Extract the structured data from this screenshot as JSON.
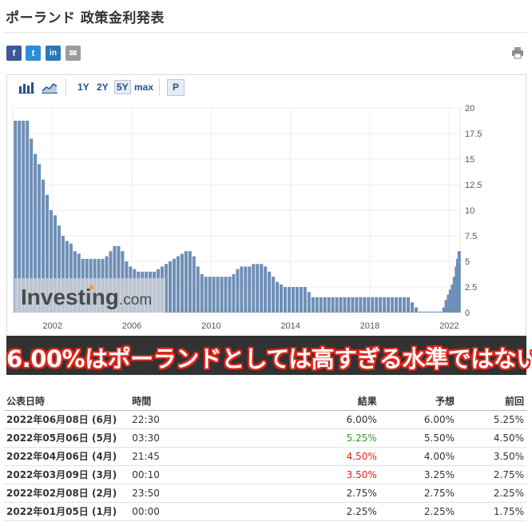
{
  "page": {
    "title": "ポーランド 政策金利発表"
  },
  "share": {
    "facebook": "f",
    "twitter": "t",
    "linkedin": "in",
    "email": "✉"
  },
  "toolbar": {
    "ranges": [
      "1Y",
      "2Y",
      "5Y",
      "max"
    ],
    "active_range": "5Y",
    "p_button": "P"
  },
  "watermark": {
    "brand": "Investing",
    "suffix": ".com"
  },
  "banner": {
    "text": "6.00%はポーランドとしては高すぎる水準ではない"
  },
  "chart_data": {
    "type": "bar",
    "title": "",
    "xlabel": "",
    "ylabel": "",
    "ylim": [
      0,
      20
    ],
    "y_ticks": [
      "0",
      "2.5",
      "5",
      "7.5",
      "10",
      "12.5",
      "15",
      "17.5",
      "20"
    ],
    "x_ticks": [
      "2002",
      "2006",
      "2010",
      "2014",
      "2018",
      "2022"
    ],
    "x_range": [
      2000.0,
      2022.55
    ],
    "grid": true,
    "legend": "none",
    "color": "#6e8fb6",
    "points": [
      [
        2000.15,
        18.75
      ],
      [
        2000.35,
        18.75
      ],
      [
        2000.55,
        18.75
      ],
      [
        2000.75,
        18.75
      ],
      [
        2000.95,
        17.0
      ],
      [
        2001.15,
        15.5
      ],
      [
        2001.35,
        14.5
      ],
      [
        2001.55,
        13.0
      ],
      [
        2001.75,
        11.5
      ],
      [
        2001.95,
        10.0
      ],
      [
        2002.15,
        9.5
      ],
      [
        2002.35,
        8.5
      ],
      [
        2002.55,
        7.5
      ],
      [
        2002.75,
        7.0
      ],
      [
        2002.95,
        6.75
      ],
      [
        2003.15,
        6.0
      ],
      [
        2003.35,
        5.75
      ],
      [
        2003.55,
        5.25
      ],
      [
        2003.75,
        5.25
      ],
      [
        2003.95,
        5.25
      ],
      [
        2004.15,
        5.25
      ],
      [
        2004.35,
        5.25
      ],
      [
        2004.55,
        5.25
      ],
      [
        2004.75,
        5.5
      ],
      [
        2004.95,
        6.0
      ],
      [
        2005.15,
        6.5
      ],
      [
        2005.35,
        6.5
      ],
      [
        2005.55,
        6.0
      ],
      [
        2005.75,
        5.0
      ],
      [
        2005.95,
        4.5
      ],
      [
        2006.15,
        4.25
      ],
      [
        2006.35,
        4.0
      ],
      [
        2006.55,
        4.0
      ],
      [
        2006.75,
        4.0
      ],
      [
        2006.95,
        4.0
      ],
      [
        2007.15,
        4.0
      ],
      [
        2007.35,
        4.25
      ],
      [
        2007.55,
        4.5
      ],
      [
        2007.75,
        4.75
      ],
      [
        2007.95,
        5.0
      ],
      [
        2008.15,
        5.25
      ],
      [
        2008.35,
        5.5
      ],
      [
        2008.55,
        5.75
      ],
      [
        2008.75,
        6.0
      ],
      [
        2008.95,
        6.0
      ],
      [
        2009.15,
        5.5
      ],
      [
        2009.35,
        4.5
      ],
      [
        2009.55,
        3.75
      ],
      [
        2009.75,
        3.5
      ],
      [
        2009.95,
        3.5
      ],
      [
        2010.15,
        3.5
      ],
      [
        2010.35,
        3.5
      ],
      [
        2010.55,
        3.5
      ],
      [
        2010.75,
        3.5
      ],
      [
        2010.95,
        3.5
      ],
      [
        2011.15,
        3.75
      ],
      [
        2011.35,
        4.25
      ],
      [
        2011.55,
        4.5
      ],
      [
        2011.75,
        4.5
      ],
      [
        2011.95,
        4.5
      ],
      [
        2012.15,
        4.75
      ],
      [
        2012.35,
        4.75
      ],
      [
        2012.55,
        4.75
      ],
      [
        2012.75,
        4.5
      ],
      [
        2012.95,
        4.0
      ],
      [
        2013.15,
        3.5
      ],
      [
        2013.35,
        3.0
      ],
      [
        2013.55,
        2.75
      ],
      [
        2013.75,
        2.5
      ],
      [
        2013.95,
        2.5
      ],
      [
        2014.15,
        2.5
      ],
      [
        2014.35,
        2.5
      ],
      [
        2014.55,
        2.5
      ],
      [
        2014.75,
        2.5
      ],
      [
        2014.95,
        2.0
      ],
      [
        2015.15,
        1.5
      ],
      [
        2015.35,
        1.5
      ],
      [
        2015.55,
        1.5
      ],
      [
        2015.75,
        1.5
      ],
      [
        2015.95,
        1.5
      ],
      [
        2016.15,
        1.5
      ],
      [
        2016.35,
        1.5
      ],
      [
        2016.55,
        1.5
      ],
      [
        2016.75,
        1.5
      ],
      [
        2016.95,
        1.5
      ],
      [
        2017.15,
        1.5
      ],
      [
        2017.35,
        1.5
      ],
      [
        2017.55,
        1.5
      ],
      [
        2017.75,
        1.5
      ],
      [
        2017.95,
        1.5
      ],
      [
        2018.15,
        1.5
      ],
      [
        2018.35,
        1.5
      ],
      [
        2018.55,
        1.5
      ],
      [
        2018.75,
        1.5
      ],
      [
        2018.95,
        1.5
      ],
      [
        2019.15,
        1.5
      ],
      [
        2019.35,
        1.5
      ],
      [
        2019.55,
        1.5
      ],
      [
        2019.75,
        1.5
      ],
      [
        2019.95,
        1.5
      ],
      [
        2020.15,
        1.0
      ],
      [
        2020.35,
        0.5
      ],
      [
        2020.55,
        0.1
      ],
      [
        2020.75,
        0.1
      ],
      [
        2020.95,
        0.1
      ],
      [
        2021.15,
        0.1
      ],
      [
        2021.35,
        0.1
      ],
      [
        2021.55,
        0.1
      ],
      [
        2021.75,
        0.5
      ],
      [
        2021.87,
        1.25
      ],
      [
        2021.98,
        1.75
      ],
      [
        2022.08,
        2.25
      ],
      [
        2022.18,
        2.75
      ],
      [
        2022.28,
        3.5
      ],
      [
        2022.38,
        4.5
      ],
      [
        2022.45,
        5.25
      ],
      [
        2022.52,
        6.0
      ]
    ]
  },
  "table": {
    "headers": {
      "date": "公表日時",
      "time": "時間",
      "actual": "結果",
      "forecast": "予想",
      "previous": "前回"
    },
    "rows": [
      {
        "date": "2022年06月08日 (6月)",
        "time": "22:30",
        "actual": "6.00%",
        "actual_color": "#333333",
        "forecast": "6.00%",
        "previous": "5.25%"
      },
      {
        "date": "2022年05月06日 (5月)",
        "time": "03:30",
        "actual": "5.25%",
        "actual_color": "#3a9a2b",
        "forecast": "5.50%",
        "previous": "4.50%"
      },
      {
        "date": "2022年04月06日 (4月)",
        "time": "21:45",
        "actual": "4.50%",
        "actual_color": "#e0201f",
        "forecast": "4.00%",
        "previous": "3.50%"
      },
      {
        "date": "2022年03月09日 (3月)",
        "time": "00:10",
        "actual": "3.50%",
        "actual_color": "#e0201f",
        "forecast": "3.25%",
        "previous": "2.75%"
      },
      {
        "date": "2022年02月08日 (2月)",
        "time": "23:50",
        "actual": "2.75%",
        "actual_color": "#333333",
        "forecast": "2.75%",
        "previous": "2.25%"
      },
      {
        "date": "2022年01月05日 (1月)",
        "time": "00:00",
        "actual": "2.25%",
        "actual_color": "#333333",
        "forecast": "2.25%",
        "previous": "1.75%"
      }
    ]
  }
}
